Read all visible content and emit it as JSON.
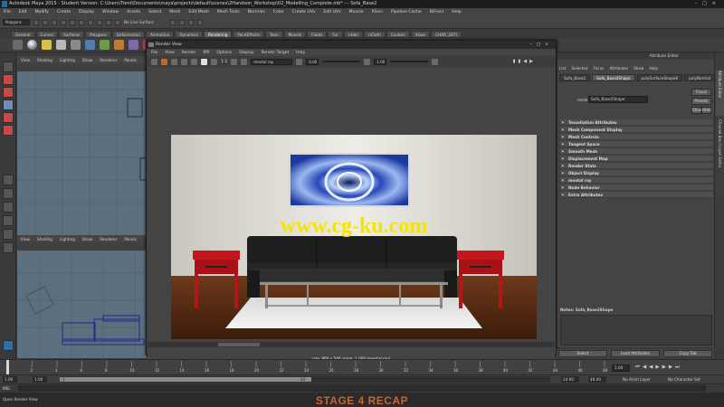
{
  "window": {
    "title": "Autodesk Maya 2015 - Student Version: C:\\Users\\Trent\\Documents\\maya\\projects\\default\\scenes\\2Handson_Workshop\\02_Modelling_Complete.mb* --- Sofa_Base2"
  },
  "menubar": [
    "File",
    "Edit",
    "Modify",
    "Create",
    "Display",
    "Window",
    "Assets",
    "Select",
    "Mesh",
    "Edit Mesh",
    "Mesh Tools",
    "Normals",
    "Color",
    "Create UVs",
    "Edit UVs",
    "Muscle",
    "XGen",
    "Pipeline Cache",
    "BiFrost",
    "Help"
  ],
  "statusline": {
    "mode": "Polygons",
    "no_live_surface": "No Live Surface"
  },
  "shelf_tabs": [
    "General",
    "Curves",
    "Surfaces",
    "Polygons",
    "Deformation",
    "Animation",
    "Dynamics",
    "Rendering",
    "PaintEffects",
    "Toon",
    "Muscle",
    "Fluids",
    "Fur",
    "nHair",
    "nCloth",
    "Custom",
    "XGen",
    "CHAR_3DTI"
  ],
  "active_shelf_tab": "Rendering",
  "viewport_top": {
    "menu": [
      "View",
      "Shading",
      "Lighting",
      "Show",
      "Renderer",
      "Panels"
    ]
  },
  "viewport_bottom": {
    "menu": [
      "View",
      "Shading",
      "Lighting",
      "Show",
      "Renderer",
      "Panels"
    ]
  },
  "render_view": {
    "title": "Render View",
    "menu": [
      "File",
      "View",
      "Render",
      "IPR",
      "Options",
      "Display",
      "Render Target",
      "Help"
    ],
    "renderer": "mental ray",
    "exposure": "0.00",
    "gamma": "1.00",
    "ratio": "1:1",
    "info_line1": "size: 960 x 540  zoom: 1.000       (mental ray)",
    "info_line2": "Frame: 1     Render Time: 3:20     Camera: persp",
    "watermark": "www.cg-ku.com"
  },
  "attribute_editor": {
    "header": "Attribute Editor",
    "menu": [
      "List",
      "Selected",
      "Focus",
      "Attributes",
      "Show",
      "Help"
    ],
    "tabs": [
      "Sofa_Base2",
      "Sofa_Base2Shape",
      "polySurfaceShape6",
      "polyNormal"
    ],
    "active_tab": "Sofa_Base2Shape",
    "mesh_label": "mesh:",
    "mesh_value": "Sofa_Base2Shape",
    "focus_button": "Focus",
    "presets_button": "Presets",
    "show_button": "Show",
    "hide_button": "Hide",
    "sections": [
      "Tessellation Attributes",
      "Mesh Component Display",
      "Mesh Controls",
      "Tangent Space",
      "Smooth Mesh",
      "Displacement Map",
      "Render Stats",
      "Object Display",
      "mental ray",
      "Node Behavior",
      "Extra Attributes"
    ],
    "notes_label": "Notes:  Sofa_Base2Shape",
    "select_button": "Select",
    "load_attributes_button": "Load Attributes",
    "copy_tab_button": "Copy Tab"
  },
  "side_tabs": [
    "Attribute Editor",
    "Channel Box / Layer Editor"
  ],
  "timeline": {
    "ticks": [
      "1",
      "2",
      "4",
      "6",
      "8",
      "10",
      "12",
      "14",
      "16",
      "18",
      "20",
      "22",
      "24",
      "26",
      "28",
      "30",
      "32",
      "34",
      "36",
      "38",
      "40",
      "42",
      "44",
      "46",
      "48"
    ],
    "current_frame": "1.00"
  },
  "range": {
    "start": "1.00",
    "start_inner": "1.00",
    "slider_start": "1",
    "slider_end": "24",
    "end_inner": "24.00",
    "end": "48.00",
    "anim_layer": "No Anim Layer",
    "char_set": "No Character Set"
  },
  "command_line": {
    "lang": "MEL"
  },
  "help_line": {
    "text": "Open Render View"
  },
  "overlay": {
    "stage_label": "STAGE 4 RECAP"
  },
  "colors": {
    "accent_tab": "#5f5f5f",
    "stage_label": "#c8652f",
    "watermark": "#f2e600",
    "red_table": "#c4171d",
    "painting_blue": "#1e4fbf"
  }
}
